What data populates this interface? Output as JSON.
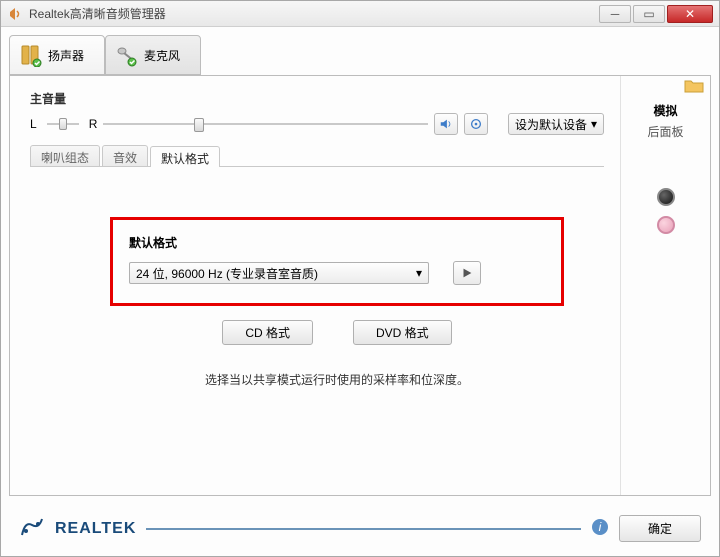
{
  "window": {
    "title": "Realtek高清晰音频管理器"
  },
  "mainTabs": {
    "speaker": "扬声器",
    "mic": "麦克风"
  },
  "volume": {
    "title": "主音量",
    "leftLabel": "L",
    "rightLabel": "R",
    "setDefault": "设为默认设备"
  },
  "subTabs": {
    "config": "喇叭组态",
    "effect": "音效",
    "default": "默认格式"
  },
  "defaultFormat": {
    "title": "默认格式",
    "selected": "24 位, 96000 Hz (专业录音室音质)",
    "cdBtn": "CD 格式",
    "dvdBtn": "DVD 格式",
    "hint": "选择当以共享模式运行时使用的采样率和位深度。"
  },
  "rightPanel": {
    "title": "模拟",
    "sub": "后面板"
  },
  "footer": {
    "brand": "REALTEK",
    "ok": "确定"
  }
}
